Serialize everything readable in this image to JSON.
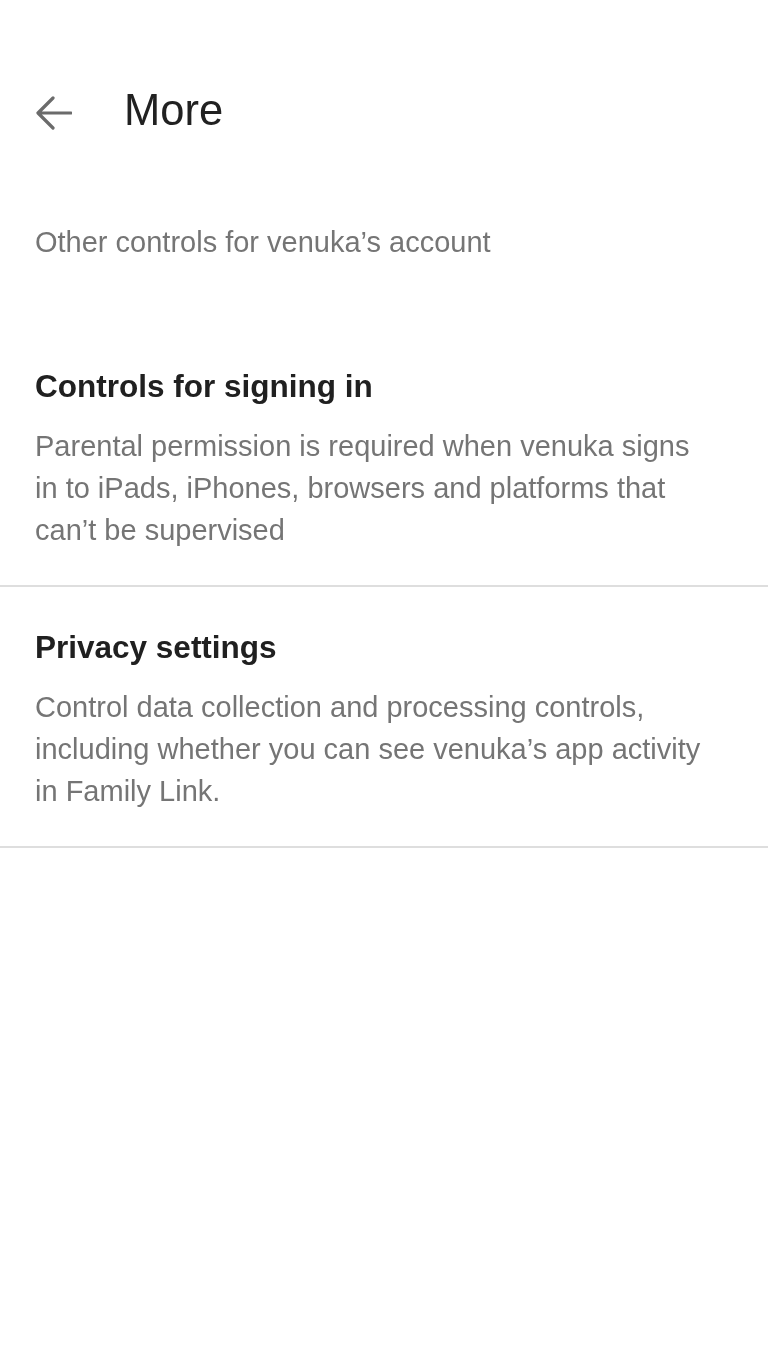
{
  "header": {
    "title": "More"
  },
  "subtitle": "Other controls for venuka’s account",
  "sections": [
    {
      "title": "Controls for signing in",
      "description": "Parental permission is required when venuka signs in to iPads, iPhones, browsers and platforms that can’t be supervised"
    },
    {
      "title": "Privacy settings",
      "description": "Control data collection and processing controls, including whether you can see venuka’s app activity in Family Link."
    }
  ]
}
